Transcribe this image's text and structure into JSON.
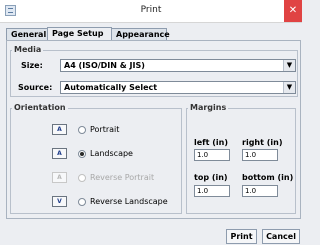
{
  "window": {
    "title": "Print"
  },
  "tabs": [
    {
      "label": "General"
    },
    {
      "label": "Page Setup"
    },
    {
      "label": "Appearance"
    }
  ],
  "media": {
    "title": "Media",
    "size_label": "Size:",
    "size_value": "A4 (ISO/DIN & JIS)",
    "source_label": "Source:",
    "source_value": "Automatically Select"
  },
  "orientation": {
    "title": "Orientation",
    "options": [
      {
        "label": "Portrait",
        "icon_text": "A",
        "checked": false,
        "enabled": true
      },
      {
        "label": "Landscape",
        "icon_text": "A",
        "checked": true,
        "enabled": true
      },
      {
        "label": "Reverse Portrait",
        "icon_text": "A",
        "checked": false,
        "enabled": false
      },
      {
        "label": "Reverse Landscape",
        "icon_text": "V",
        "checked": false,
        "enabled": true
      }
    ]
  },
  "margins": {
    "title": "Margins",
    "left_label": "left (in)",
    "right_label": "right (in)",
    "top_label": "top (in)",
    "bottom_label": "bottom (in)",
    "left_value": "1.0",
    "right_value": "1.0",
    "top_value": "1.0",
    "bottom_value": "1.0"
  },
  "buttons": {
    "print": "Print",
    "cancel": "Cancel"
  },
  "icons": {
    "app": "printer-window-icon",
    "close": "close-icon"
  },
  "colors": {
    "close": "#e04343",
    "accent": "#1f3d8a"
  }
}
